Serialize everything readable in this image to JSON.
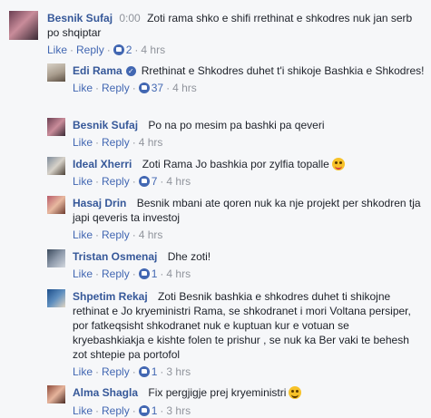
{
  "comments": [
    {
      "author": "Besnik Sufaj",
      "timestamp_inline": "0:00",
      "text": "Zoti rama shko e shifi rrethinat e shkodres nuk jan serb po shqiptar",
      "like": "Like",
      "reply": "Reply",
      "likes": "2",
      "time": "4 hrs"
    },
    {
      "author": "Edi Rama",
      "verified": true,
      "text": "Rrethinat e Shkodres duhet t'i shikoje Bashkia e Shkodres!",
      "like": "Like",
      "reply": "Reply",
      "likes": "37",
      "time": "4 hrs"
    },
    {
      "author": "Besnik Sufaj",
      "text": "Po na po mesim pa bashki pa qeveri",
      "like": "Like",
      "reply": "Reply",
      "time": "4 hrs"
    },
    {
      "author": "Ideal Xherri",
      "text": "Zoti Rama Jo bashkia por zylfia topalle",
      "emoji": "winking-tongue-emoji",
      "like": "Like",
      "reply": "Reply",
      "likes": "7",
      "time": "4 hrs"
    },
    {
      "author": "Hasaj Drin",
      "text": "Besnik mbani ate qoren nuk ka nje projekt per shkodren tja japi qeveris ta investoj",
      "like": "Like",
      "reply": "Reply",
      "time": "4 hrs"
    },
    {
      "author": "Tristan Osmenaj",
      "text": "Dhe zoti!",
      "like": "Like",
      "reply": "Reply",
      "likes": "1",
      "time": "4 hrs"
    },
    {
      "author": "Shpetim Rekaj",
      "text": "Zoti Besnik bashkia e shkodres duhet ti shikojne rethinat e Jo kryeministri Rama, se shkodranet i mori Voltana persiper, por fatkeqsisht shkodranet nuk e kuptuan kur e votuan se kryebashkiakja e kishte folen te prishur , se nuk ka Ber vaki te behesh zot shtepie pa portofol",
      "like": "Like",
      "reply": "Reply",
      "likes": "1",
      "time": "3 hrs"
    },
    {
      "author": "Alma Shagla",
      "text": "Fix pergjigje prej kryeministri",
      "emoji": "smiling-emoji",
      "like": "Like",
      "reply": "Reply",
      "likes": "1",
      "time": "3 hrs"
    }
  ],
  "colors": {
    "author": "#365899",
    "link": "#4267b2",
    "meta": "#90949c",
    "background": "#f6f7f9"
  }
}
